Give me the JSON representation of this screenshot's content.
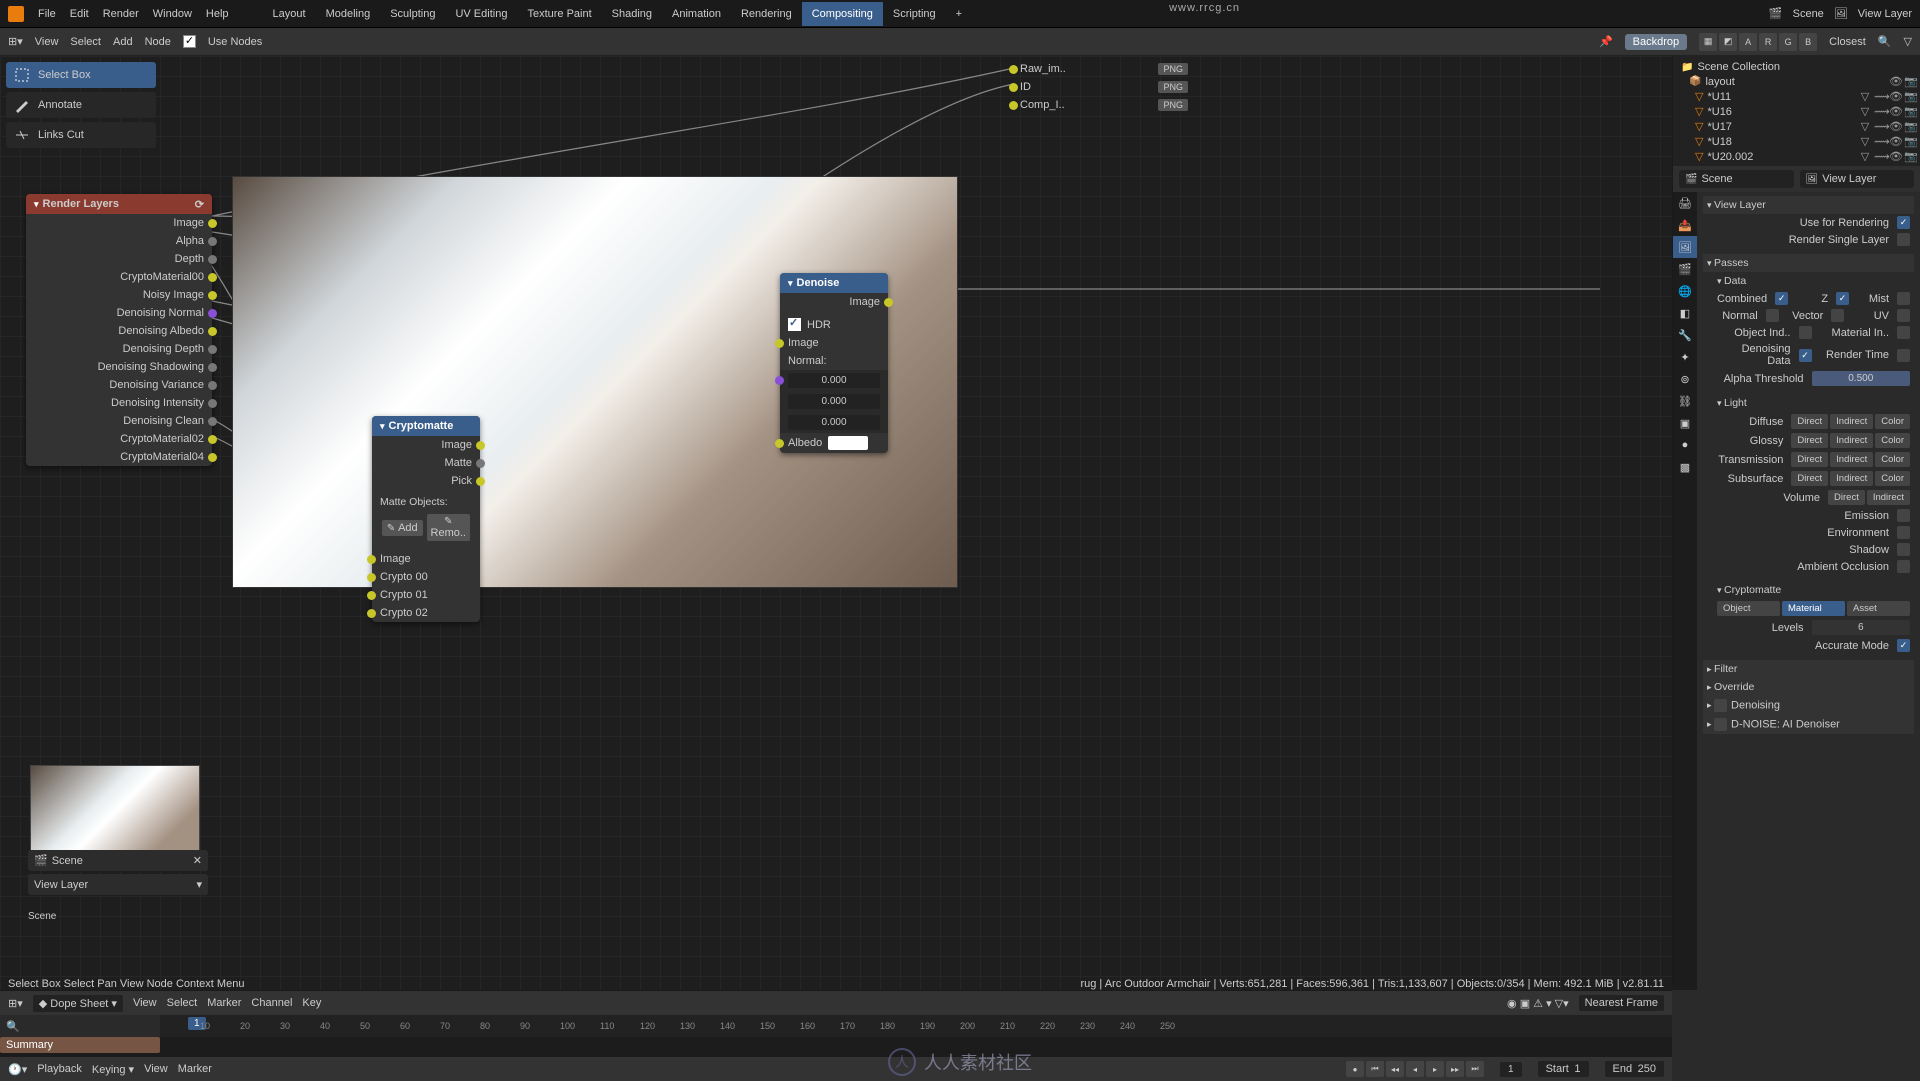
{
  "watermark": "www.rrcg.cn",
  "wm_han": "人人素材社区",
  "topbar": {
    "menu": [
      "File",
      "Edit",
      "Render",
      "Window",
      "Help"
    ],
    "tabs": [
      "Layout",
      "Modeling",
      "Sculpting",
      "UV Editing",
      "Texture Paint",
      "Shading",
      "Animation",
      "Rendering",
      "Compositing",
      "Scripting",
      "+"
    ],
    "active_tab": "Compositing",
    "scene": "Scene",
    "viewlayer": "View Layer"
  },
  "header2": {
    "items": [
      "View",
      "Select",
      "Add",
      "Node"
    ],
    "use_nodes": "Use Nodes",
    "backdrop": "Backdrop",
    "closest": "Closest",
    "letters": [
      "A",
      "R",
      "G",
      "B"
    ]
  },
  "tools": {
    "select": "Select Box",
    "annotate": "Annotate",
    "links": "Links Cut"
  },
  "render_layers": {
    "title": "Render Layers",
    "outs": [
      "Image",
      "Alpha",
      "Depth",
      "CryptoMaterial00",
      "Noisy Image",
      "Denoising Normal",
      "Denoising Albedo",
      "Denoising Depth",
      "Denoising Shadowing",
      "Denoising Variance",
      "Denoising Intensity",
      "Denoising Clean",
      "CryptoMaterial02",
      "CryptoMaterial04"
    ]
  },
  "crypto": {
    "title": "Cryptomatte",
    "outs": [
      "Image",
      "Matte",
      "Pick"
    ],
    "matte_label": "Matte Objects:",
    "add": "Add",
    "remove": "Remo..",
    "ins": [
      "Image",
      "Crypto 00",
      "Crypto 01",
      "Crypto 02"
    ]
  },
  "denoise": {
    "title": "Denoise",
    "out": "Image",
    "hdr": "HDR",
    "ins": [
      "Image",
      "Normal:",
      "0.000",
      "0.000",
      "0.000",
      "Albedo"
    ]
  },
  "fileout": {
    "rows": [
      [
        "Raw_im..",
        "PNG"
      ],
      [
        "ID",
        "PNG"
      ],
      [
        "Comp_I..",
        "PNG"
      ]
    ]
  },
  "scene_dd": {
    "scene": "Scene",
    "layer": "View Layer"
  },
  "scene_label": "Scene",
  "outliner": {
    "coll": "Scene Collection",
    "layout": "layout",
    "items": [
      "*U11",
      "*U16",
      "*U17",
      "*U18",
      "*U20.002"
    ]
  },
  "props": {
    "scene": "Scene",
    "vl": "View Layer",
    "sect_vl": "View Layer",
    "use_render": "Use for Rendering",
    "single": "Render Single Layer",
    "sect_passes": "Passes",
    "sect_data": "Data",
    "combined": "Combined",
    "z": "Z",
    "mist": "Mist",
    "normal": "Normal",
    "vector": "Vector",
    "uv": "UV",
    "objind": "Object Ind..",
    "matin": "Material In..",
    "dendata": "Denoising Data",
    "rtime": "Render Time",
    "alpha": "Alpha Threshold",
    "alpha_v": "0.500",
    "sect_light": "Light",
    "diffuse": "Diffuse",
    "glossy": "Glossy",
    "trans": "Transmission",
    "subs": "Subsurface",
    "volume": "Volume",
    "direct": "Direct",
    "indirect": "Indirect",
    "color": "Color",
    "emission": "Emission",
    "env": "Environment",
    "shadow": "Shadow",
    "ao": "Ambient Occlusion",
    "sect_crypto": "Cryptomatte",
    "c_obj": "Object",
    "c_mat": "Material",
    "c_asset": "Asset",
    "levels": "Levels",
    "levels_v": "6",
    "accurate": "Accurate Mode",
    "sect_filter": "Filter",
    "sect_override": "Override",
    "sect_den": "Denoising",
    "sect_dnoise": "D-NOISE: AI Denoiser"
  },
  "dope": {
    "title": "Dope Sheet",
    "menu": [
      "View",
      "Select",
      "Marker",
      "Channel",
      "Key"
    ],
    "nearest": "Nearest Frame",
    "summary": "Summary",
    "ticks": [
      1,
      10,
      20,
      30,
      40,
      50,
      60,
      70,
      80,
      90,
      100,
      110,
      120,
      130,
      140,
      150,
      160,
      170,
      180,
      190,
      200,
      210,
      220,
      230,
      240,
      250
    ]
  },
  "playback": {
    "menu": [
      "Playback",
      "Keying",
      "View",
      "Marker"
    ],
    "cur": "1",
    "start_l": "Start",
    "start": "1",
    "end_l": "End",
    "end": "250"
  },
  "status": {
    "left": "  Select    Box Select    Pan View    Node Context Menu",
    "right": "rug | Arc Outdoor Armchair | Verts:651,281 | Faces:596,361 | Tris:1,133,607 | Objects:0/354 | Mem: 492.1 MiB | v2.81.11"
  }
}
